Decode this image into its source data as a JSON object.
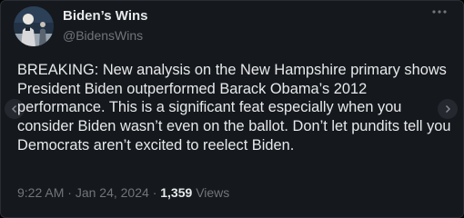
{
  "author": {
    "display_name": "Biden’s Wins",
    "handle": "@BidensWins",
    "avatar_icon": "avatar-photo"
  },
  "tweet": {
    "text": "BREAKING: New analysis on the New Hampshire primary shows President Biden outperformed Barack Obama’s 2012 performance. This is a significant feat especially when you consider Biden wasn’t even on the ballot. Don’t let pundits tell you Democrats aren’t excited to reelect Biden.",
    "time": "9:22 AM",
    "date": "Jan 24, 2024",
    "separator": "·",
    "views_count": "1,359",
    "views_label": "Views"
  },
  "icons": {
    "more": "more-options-icon",
    "prev": "chevron-left-icon",
    "next": "chevron-right-icon"
  },
  "colors": {
    "background": "#15181d",
    "primary_text": "#e7e9ea",
    "secondary_text": "#71767b"
  }
}
